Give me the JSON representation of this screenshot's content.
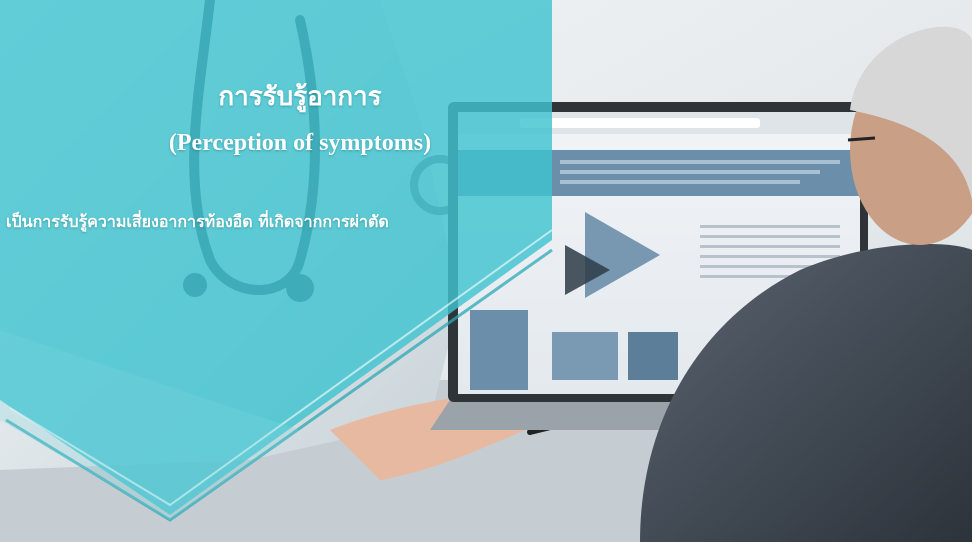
{
  "slide": {
    "title_th": "การรับรู้อาการ",
    "title_en": "(Perception of symptoms)",
    "body_th": "เป็นการรับรู้ความเสี่ยงอาการท้องอืด ที่เกิดจากการผ่าตัด"
  },
  "colors": {
    "teal_overlay": "#3fc3cf",
    "teal_dark": "#2aa8b6",
    "text": "#ffffff"
  }
}
